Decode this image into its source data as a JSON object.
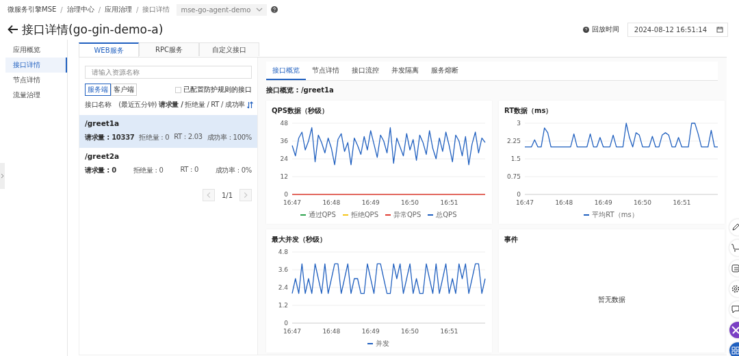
{
  "breadcrumb": {
    "items": [
      "微服务引擎MSE",
      "治理中心",
      "应用治理",
      "接口详情"
    ],
    "separator": "/",
    "app_select": {
      "value": "mse-go-agent-demo",
      "disabled": true
    }
  },
  "header": {
    "title": "接口详情(go-gin-demo-a)",
    "replay_label": "回放时间",
    "replay_time": "2024-08-12 16:51:14"
  },
  "sidebar": {
    "items": [
      {
        "label": "应用概览",
        "selected": false
      },
      {
        "label": "接口详情",
        "selected": true
      },
      {
        "label": "节点详情",
        "selected": false
      },
      {
        "label": "流量治理",
        "selected": false
      }
    ]
  },
  "tabs": [
    {
      "label": "WEB服务",
      "selected": true
    },
    {
      "label": "RPC服务",
      "selected": false
    },
    {
      "label": "自定义接口",
      "selected": false
    }
  ],
  "resource_list": {
    "search": {
      "placeholder": "请输入资源名称"
    },
    "segments": [
      {
        "label": "服务端",
        "selected": true
      },
      {
        "label": "客户端",
        "selected": false
      }
    ],
    "filter": {
      "label": "已配置防护规则的接口",
      "checked": false
    },
    "header": {
      "name": "接口名称",
      "metrics": "(最近五分钟) **请求量 /** 拒绝量 / RT / 成功率"
    },
    "rows": [
      {
        "name": "/greet1a",
        "selected": true,
        "stats": [
          "请求量 : 10337",
          "拒绝量 : 0",
          "RT : 2.03",
          "成功率 : 100%"
        ]
      },
      {
        "name": "/greet2a",
        "selected": false,
        "stats": [
          "请求量 : 0",
          "拒绝量 : 0",
          "RT : 0",
          "成功率 : 0%"
        ]
      }
    ],
    "pagination": {
      "page": "1/1",
      "prev_disabled": true,
      "next_disabled": true
    }
  },
  "detail": {
    "tabs": [
      {
        "label": "接口概览",
        "selected": true
      },
      {
        "label": "节点详情",
        "selected": false
      },
      {
        "label": "接口流控",
        "selected": false
      },
      {
        "label": "并发隔离",
        "selected": false
      },
      {
        "label": "服务熔断",
        "selected": false
      }
    ],
    "subtitle": "接口概览 : /greet1a",
    "cards": [
      {
        "kind": "chart",
        "title": "QPS数据（秒级）",
        "chart_data": {
          "type": "line",
          "grid": true,
          "categories": [
            "16:47",
            null,
            null,
            null,
            null,
            null,
            null,
            null,
            null,
            null,
            null,
            null,
            "16:48",
            null,
            null,
            null,
            null,
            null,
            null,
            null,
            null,
            null,
            null,
            null,
            "16:49",
            null,
            null,
            null,
            null,
            null,
            null,
            null,
            null,
            null,
            null,
            null,
            "16:50",
            null,
            null,
            null,
            null,
            null,
            null,
            null,
            null,
            null,
            null,
            null,
            "16:51",
            null,
            null,
            null,
            null,
            null,
            null,
            null,
            null,
            null,
            null,
            null
          ],
          "ylim": [
            0,
            48
          ],
          "yticks": [
            0,
            12,
            24,
            36,
            48
          ],
          "series": [
            {
              "name": "通过QPS",
              "color": "#2ba14b",
              "values": [
                null,
                null,
                null,
                null,
                null,
                null,
                null,
                null,
                null,
                null,
                null,
                null,
                null,
                null,
                null,
                null,
                null,
                null,
                null,
                null,
                null,
                null,
                null,
                null,
                null,
                null,
                null,
                null,
                null,
                null,
                null,
                null,
                null,
                null,
                null,
                null,
                null,
                null,
                null,
                null,
                null,
                null,
                null,
                null,
                null,
                null,
                null,
                null,
                null,
                null,
                null,
                null,
                null,
                null,
                null,
                null,
                null,
                null,
                null,
                null
              ]
            },
            {
              "name": "拒绝QPS",
              "color": "#f5c518",
              "values": [
                null,
                null,
                null,
                null,
                null,
                null,
                null,
                null,
                null,
                null,
                null,
                null,
                null,
                null,
                null,
                null,
                null,
                null,
                null,
                null,
                null,
                null,
                null,
                null,
                null,
                null,
                null,
                null,
                null,
                null,
                null,
                null,
                null,
                null,
                null,
                null,
                null,
                null,
                null,
                null,
                null,
                null,
                null,
                null,
                null,
                null,
                null,
                null,
                null,
                null,
                null,
                null,
                null,
                null,
                null,
                null,
                null,
                null,
                null,
                null
              ]
            },
            {
              "name": "异常QPS",
              "color": "#e03c31",
              "values": [
                0,
                0,
                0,
                0,
                0,
                0,
                0,
                0,
                0,
                0,
                0,
                0,
                0,
                0,
                0,
                0,
                0,
                0,
                0,
                0,
                0,
                0,
                0,
                0,
                0,
                0,
                0,
                0,
                0,
                0,
                0,
                0,
                0,
                0,
                0,
                0,
                0,
                0,
                0,
                0,
                0,
                0,
                0,
                0,
                0,
                0,
                0,
                0,
                0,
                0,
                0,
                0,
                0,
                0,
                0,
                0,
                0,
                0,
                0,
                0
              ]
            },
            {
              "name": "总QPS",
              "color": "#1f5fbf",
              "values": [
                33,
                26,
                38,
                42,
                30,
                36,
                45,
                22,
                40,
                35,
                28,
                38,
                31,
                20,
                37,
                41,
                29,
                35,
                20,
                38,
                33,
                27,
                39,
                30,
                43,
                34,
                25,
                40,
                36,
                28,
                45,
                21,
                38,
                32,
                26,
                41,
                30,
                37,
                23,
                40,
                35,
                27,
                43,
                31,
                24,
                38,
                29,
                42,
                33,
                22,
                40,
                36,
                26,
                39,
                20,
                34,
                42,
                28,
                38,
                35
              ]
            }
          ]
        }
      },
      {
        "kind": "chart",
        "title": "RT数据（ms）",
        "chart_data": {
          "type": "line",
          "grid": true,
          "categories": [
            "16:47",
            null,
            null,
            null,
            null,
            null,
            null,
            null,
            null,
            null,
            null,
            null,
            "16:48",
            null,
            null,
            null,
            null,
            null,
            null,
            null,
            null,
            null,
            null,
            null,
            "16:49",
            null,
            null,
            null,
            null,
            null,
            null,
            null,
            null,
            null,
            null,
            null,
            "16:50",
            null,
            null,
            null,
            null,
            null,
            null,
            null,
            null,
            null,
            null,
            null,
            "16:51",
            null,
            null,
            null,
            null,
            null,
            null,
            null,
            null,
            null,
            null,
            null
          ],
          "ylim": [
            0,
            3
          ],
          "yticks": [
            0,
            0.75,
            1.5,
            2.25,
            3
          ],
          "series": [
            {
              "name": "平均RT（ms）",
              "color": "#1f5fbf",
              "values": [
                2,
                2,
                2,
                2.3,
                2,
                2,
                2.8,
                2.6,
                2,
                2,
                2,
                2,
                2,
                2,
                2,
                2.55,
                2,
                2,
                2,
                2,
                2.55,
                2,
                2,
                2.4,
                2,
                2,
                2,
                2.5,
                2,
                2,
                2,
                3,
                2.4,
                2,
                2.6,
                2.5,
                2,
                2,
                2,
                2.45,
                2,
                2,
                2.5,
                2.6,
                2.5,
                2,
                2,
                2.4,
                2,
                2,
                2,
                3,
                3,
                2.55,
                2,
                2,
                2,
                2.7,
                2,
                2
              ]
            }
          ]
        }
      },
      {
        "kind": "chart",
        "title": "最大并发（秒级）",
        "chart_data": {
          "type": "line",
          "grid": true,
          "categories": [
            "16:47",
            null,
            null,
            null,
            null,
            null,
            null,
            null,
            null,
            null,
            null,
            null,
            "16:48",
            null,
            null,
            null,
            null,
            null,
            null,
            null,
            null,
            null,
            null,
            null,
            "16:49",
            null,
            null,
            null,
            null,
            null,
            null,
            null,
            null,
            null,
            null,
            null,
            "16:50",
            null,
            null,
            null,
            null,
            null,
            null,
            null,
            null,
            null,
            null,
            null,
            "16:51",
            null,
            null,
            null,
            null,
            null,
            null,
            null,
            null,
            null,
            null,
            null
          ],
          "ylim": [
            0,
            4.8
          ],
          "yticks": [
            0,
            1.2,
            2.4,
            3.6,
            4.8
          ],
          "series": [
            {
              "name": "并发",
              "color": "#1f5fbf",
              "values": [
                2,
                3,
                2,
                4,
                2,
                3,
                2,
                4,
                3,
                2,
                4,
                2,
                3,
                4,
                4,
                2,
                3,
                4,
                2,
                3,
                3,
                2,
                2,
                4,
                3,
                2,
                4,
                4,
                3,
                2,
                2,
                4,
                3,
                4,
                2,
                3,
                4,
                2,
                3,
                2,
                2,
                4,
                3,
                2,
                4,
                2,
                3,
                4,
                2,
                3,
                2,
                4,
                3,
                4,
                2,
                3,
                4,
                4,
                2,
                3
              ]
            }
          ]
        }
      },
      {
        "kind": "empty",
        "title": "事件",
        "message": "暂无数据"
      }
    ]
  }
}
